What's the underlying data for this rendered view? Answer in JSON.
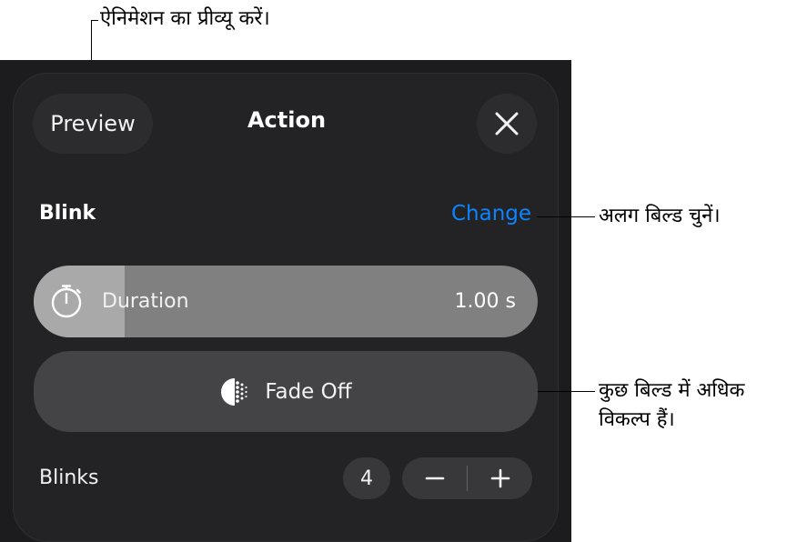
{
  "callouts": {
    "preview": "ऐनिमेशन का प्रीव्यू करें।",
    "change": "अलग बिल्ड चुनें।",
    "more_options_line1": "कुछ बिल्ड में अधिक",
    "more_options_line2": "विकल्प हैं।"
  },
  "header": {
    "preview_label": "Preview",
    "title": "Action",
    "close_icon": "close-icon"
  },
  "build": {
    "name": "Blink",
    "change_label": "Change"
  },
  "duration": {
    "label": "Duration",
    "value": "1.00 s",
    "icon": "stopwatch-icon",
    "fill_fraction": 0.18
  },
  "direction": {
    "label": "Fade Off",
    "icon": "fade-off-icon"
  },
  "blinks": {
    "label": "Blinks",
    "count": "4",
    "decrement_icon": "minus-icon",
    "increment_icon": "plus-icon"
  },
  "colors": {
    "accent": "#0a84ff",
    "panel": "#1c1c1e"
  }
}
